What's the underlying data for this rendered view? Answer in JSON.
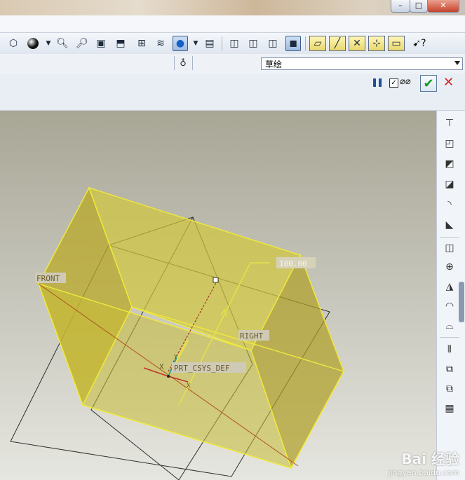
{
  "window": {
    "minimize_glyph": "–",
    "maximize_glyph": "□",
    "close_glyph": "✕"
  },
  "toolbar": {
    "icons": [
      "repaint-icon",
      "shading-icon",
      "zoom-in-icon",
      "zoom-out-icon",
      "refit-icon",
      "reorient-icon",
      "named-views-icon",
      "layers-icon",
      "datum-display-icon",
      "camera-icon",
      "display-wireframe-icon",
      "display-hidden-icon",
      "display-no-hidden-icon",
      "display-shaded-icon",
      "datum-planes-icon",
      "datum-axes-icon",
      "datum-points-icon",
      "csys-icon",
      "annotations-icon",
      "whats-this-icon"
    ]
  },
  "sketch_bar": {
    "sketch_type": "草绘",
    "pause_glyph": "❚❚",
    "preview_checked": true,
    "preview_glyph": "⌀⌀",
    "ok_glyph": "✔",
    "cancel_glyph": "✕"
  },
  "viewport": {
    "labels": {
      "front": "FRONT",
      "right": "RIGHT",
      "csys": "PRT_CSYS_DEF",
      "dimension": "100.00",
      "axis_x": "X",
      "axis_y": "Y",
      "axis_z": "X"
    },
    "colors": {
      "solid_fill": "#c9c04a",
      "solid_edge": "#f0ea3a",
      "datum_plane": "#2e2e2e",
      "dimension_line": "#e8e04a"
    }
  },
  "right_toolbar": {
    "icons": [
      "hole-icon",
      "shell-icon",
      "rib-icon",
      "draft-icon",
      "round-icon",
      "chamfer-icon",
      "extrude-icon",
      "revolve-icon",
      "sweep-icon",
      "blend-icon",
      "boundary-icon",
      "mirror-icon",
      "merge-icon",
      "trim-icon",
      "pattern-icon"
    ]
  },
  "watermark": {
    "brand": "Bai 经验",
    "url": "jingyan.baidu.com"
  }
}
